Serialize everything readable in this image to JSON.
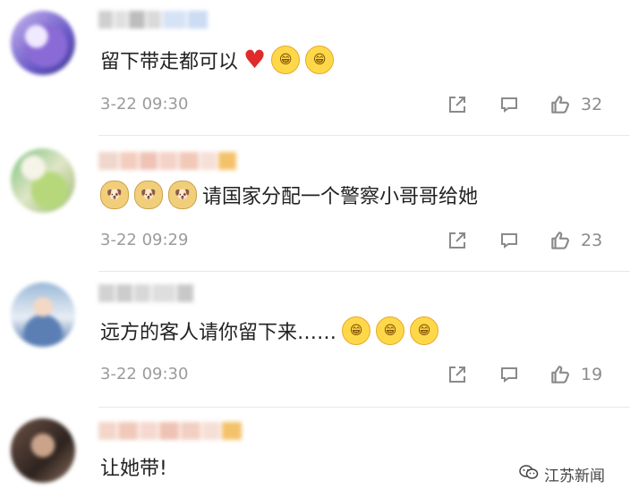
{
  "comments": [
    {
      "text": "留下带走都可以",
      "time": "3-22 09:30",
      "likes": "32"
    },
    {
      "text": "请国家分配一个警察小哥哥给她",
      "time": "3-22 09:29",
      "likes": "23"
    },
    {
      "text": "远方的客人请你留下来……",
      "time": "3-22 09:30",
      "likes": "19"
    },
    {
      "text": "让她带!"
    }
  ],
  "watermark": {
    "label": "江苏新闻"
  },
  "icons": {
    "share": "share-icon",
    "reply": "comment-icon",
    "like": "thumbs-up-icon",
    "heart": "heart-emoji",
    "grin": "grin-emoji",
    "doge": "doge-emoji"
  }
}
